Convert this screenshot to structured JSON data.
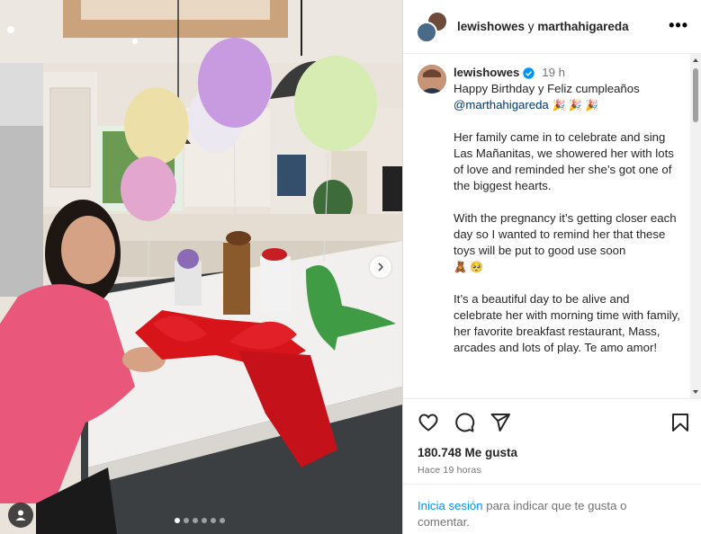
{
  "header": {
    "user1": "lewishowes",
    "conjunction": "y",
    "user2": "marthahigareda"
  },
  "caption": {
    "username": "lewishowes",
    "time": "19 h",
    "line1": "Happy Birthday y  Feliz cumpleaños",
    "mention": "@marthahigareda",
    "mention_emoji": "🎉 🎉 🎉",
    "para2": "Her family came in to celebrate and sing Las Mañanitas, we showered her with lots of love and reminded her she’s got one of the biggest hearts.",
    "para3": "With the pregnancy it’s getting closer each day so I wanted to remind her that these toys will be put to good use soon",
    "para3_emoji": "🧸 🥺",
    "para4": "It’s a beautiful day to be alive and celebrate her with morning time with family, her favorite breakfast restaurant, Mass, arcades and lots of play. Te amo amor!"
  },
  "stats": {
    "likes": "180.748 Me gusta",
    "time_ago": "Hace 19 horas"
  },
  "login": {
    "link": "Inicia sesión",
    "text": " para indicar que te gusta o comentar."
  },
  "icons": {
    "more": "more-options-icon",
    "like": "heart-icon",
    "comment": "comment-icon",
    "share": "send-icon",
    "save": "bookmark-icon",
    "next": "chevron-right-icon",
    "tag": "user-tag-icon",
    "verified": "verified-badge-icon"
  },
  "carousel": {
    "total": 6,
    "active": 1
  },
  "colors": {
    "link": "#0095f6",
    "mention": "#00376b",
    "verified": "#0095f6",
    "ribbon": "#d8141b"
  }
}
